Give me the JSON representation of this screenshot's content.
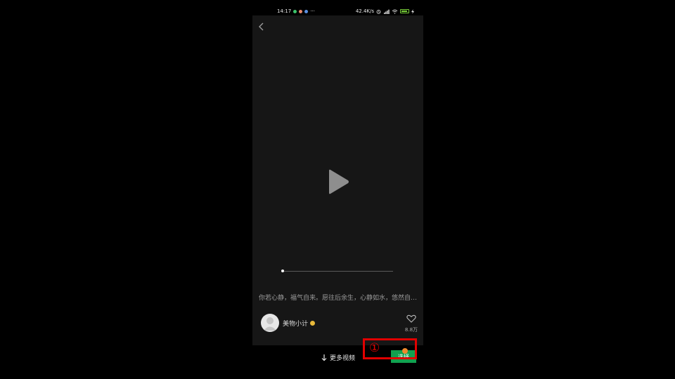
{
  "status_bar": {
    "time": "14:17",
    "left_dots": "···",
    "net_speed": "42.4K/s",
    "icons": [
      "alarm-icon",
      "signal-icon",
      "wifi-icon",
      "battery-icon",
      "charging-icon"
    ]
  },
  "video": {
    "progress": 0.0,
    "caption": "你若心静，福气自来。愿往后余生，心静如水，悠然自…"
  },
  "author": {
    "name": "美物小计"
  },
  "like": {
    "count": "8.8万"
  },
  "bottom": {
    "more_videos": "更多视频",
    "choose_label": "选择"
  },
  "annotation": {
    "number": "①"
  },
  "colors": {
    "background": "#000000",
    "video_bg": "#161616",
    "accent_green": "#12a14f",
    "annotation_red": "#e00000"
  }
}
